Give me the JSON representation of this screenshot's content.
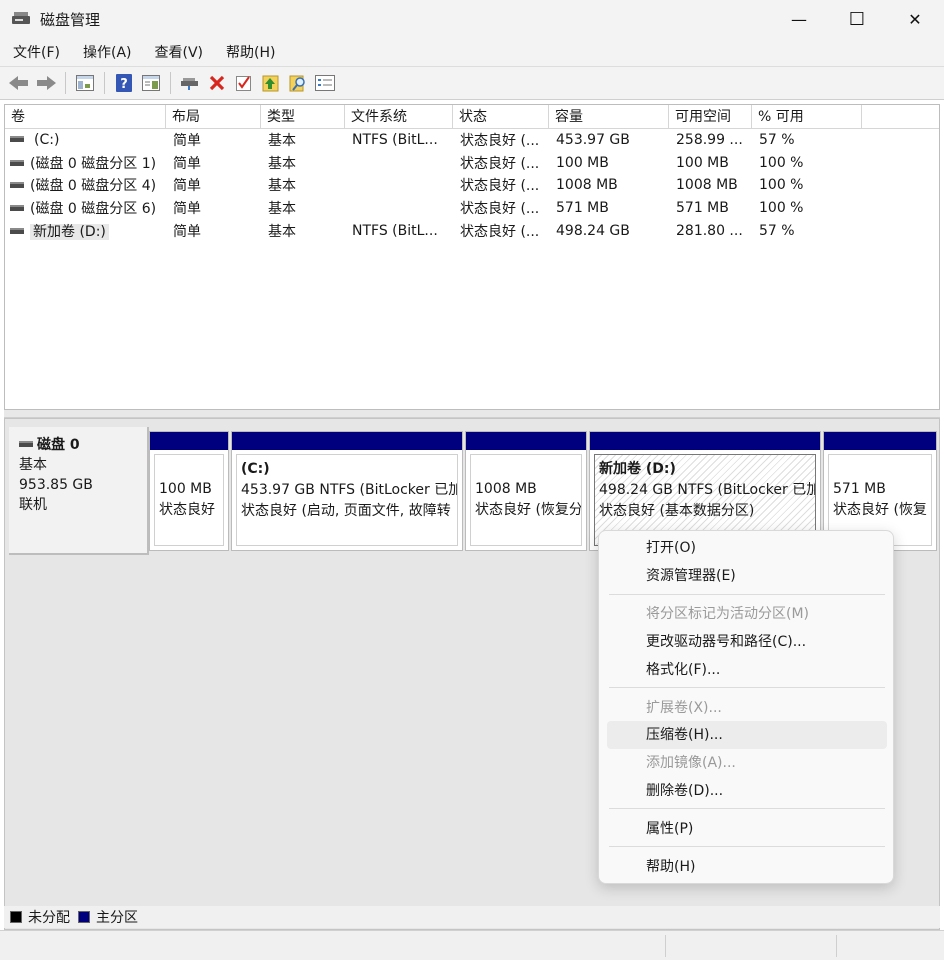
{
  "window": {
    "title": "磁盘管理",
    "minimize": "—",
    "maximize": "☐",
    "close": "✕"
  },
  "menubar": [
    "文件(F)",
    "操作(A)",
    "查看(V)",
    "帮助(H)"
  ],
  "toolbar": {
    "icons": [
      "back-arrow-icon",
      "forward-arrow-icon",
      "console-tree-icon",
      "help-icon",
      "properties-icon",
      "connect-disk-icon",
      "delete-icon",
      "check-icon",
      "import-icon",
      "search-icon",
      "list-icon"
    ]
  },
  "volumes": {
    "columns": [
      "卷",
      "布局",
      "类型",
      "文件系统",
      "状态",
      "容量",
      "可用空间",
      "% 可用"
    ],
    "rows": [
      [
        "(C:)",
        "简单",
        "基本",
        "NTFS (BitL...",
        "状态良好 (...",
        "453.97 GB",
        "258.99 ...",
        "57 %"
      ],
      [
        "(磁盘 0 磁盘分区 1)",
        "简单",
        "基本",
        "",
        "状态良好 (...",
        "100 MB",
        "100 MB",
        "100 %"
      ],
      [
        "(磁盘 0 磁盘分区 4)",
        "简单",
        "基本",
        "",
        "状态良好 (...",
        "1008 MB",
        "1008 MB",
        "100 %"
      ],
      [
        "(磁盘 0 磁盘分区 6)",
        "简单",
        "基本",
        "",
        "状态良好 (...",
        "571 MB",
        "571 MB",
        "100 %"
      ],
      [
        "新加卷 (D:)",
        "简单",
        "基本",
        "NTFS (BitL...",
        "状态良好 (...",
        "498.24 GB",
        "281.80 ...",
        "57 %"
      ]
    ]
  },
  "disk": {
    "name": "磁盘 0",
    "type": "基本",
    "size": "953.85 GB",
    "status": "联机",
    "partitions": [
      {
        "name": "",
        "line1": "100 MB",
        "line2": "状态良好"
      },
      {
        "name": "(C:)",
        "line1": "453.97 GB NTFS (BitLocker 已加",
        "line2": "状态良好 (启动, 页面文件, 故障转"
      },
      {
        "name": "",
        "line1": "1008 MB",
        "line2": "状态良好 (恢复分"
      },
      {
        "name": "新加卷  (D:)",
        "line1": "498.24 GB NTFS (BitLocker 已加",
        "line2": "状态良好 (基本数据分区)"
      },
      {
        "name": "",
        "line1": "571 MB",
        "line2": "状态良好 (恢复"
      }
    ]
  },
  "legend": {
    "unallocated": "未分配",
    "primary": "主分区",
    "unallocated_color": "#000000",
    "primary_color": "#00007f"
  },
  "context_menu": {
    "items": [
      {
        "label": "打开(O)",
        "disabled": false
      },
      {
        "label": "资源管理器(E)",
        "disabled": false
      },
      {
        "label": "将分区标记为活动分区(M)",
        "disabled": true
      },
      {
        "label": "更改驱动器号和路径(C)...",
        "disabled": false
      },
      {
        "label": "格式化(F)...",
        "disabled": false
      },
      {
        "label": "扩展卷(X)...",
        "disabled": true
      },
      {
        "label": "压缩卷(H)...",
        "disabled": false
      },
      {
        "label": "添加镜像(A)...",
        "disabled": true
      },
      {
        "label": "删除卷(D)...",
        "disabled": false
      },
      {
        "label": "属性(P)",
        "disabled": false
      },
      {
        "label": "帮助(H)",
        "disabled": false
      }
    ]
  }
}
